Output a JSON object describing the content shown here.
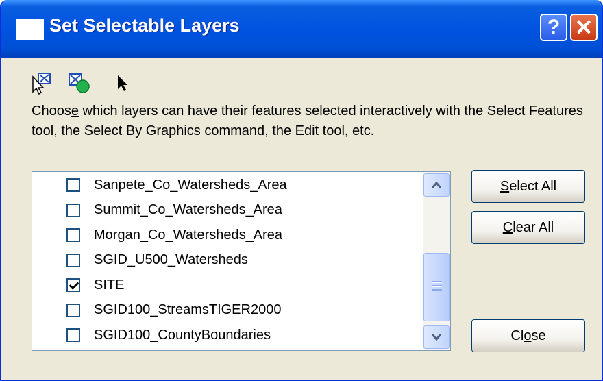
{
  "window": {
    "title": "Set Selectable Layers",
    "help_button_label": "?",
    "close_button_label": "✕"
  },
  "toolbar": {
    "icons": [
      "select-features-arrow-icon",
      "select-by-graphics-icon",
      "pointer-arrow-icon"
    ]
  },
  "description": {
    "before": "Choos",
    "accel": "e",
    "after": " which layers can have their features selected interactively with the Select Features tool, the Select By Graphics command, the Edit tool, etc."
  },
  "layers": [
    {
      "label": "Sanpete_Co_Watersheds_Area",
      "checked": false
    },
    {
      "label": "Summit_Co_Watersheds_Area",
      "checked": false
    },
    {
      "label": "Morgan_Co_Watersheds_Area",
      "checked": false
    },
    {
      "label": "SGID_U500_Watersheds",
      "checked": false
    },
    {
      "label": "SITE",
      "checked": true
    },
    {
      "label": "SGID100_StreamsTIGER2000",
      "checked": false
    },
    {
      "label": "SGID100_CountyBoundaries",
      "checked": false
    }
  ],
  "buttons": {
    "select_all": {
      "accel": "S",
      "rest": "elect All"
    },
    "clear_all": {
      "accel": "C",
      "rest": "lear All"
    },
    "close": {
      "before": "Cl",
      "accel": "o",
      "after": "se"
    }
  },
  "colors": {
    "titlebar": "#0053e0",
    "dialog_bg": "#ece9d8",
    "close_button": "#d9532c"
  }
}
